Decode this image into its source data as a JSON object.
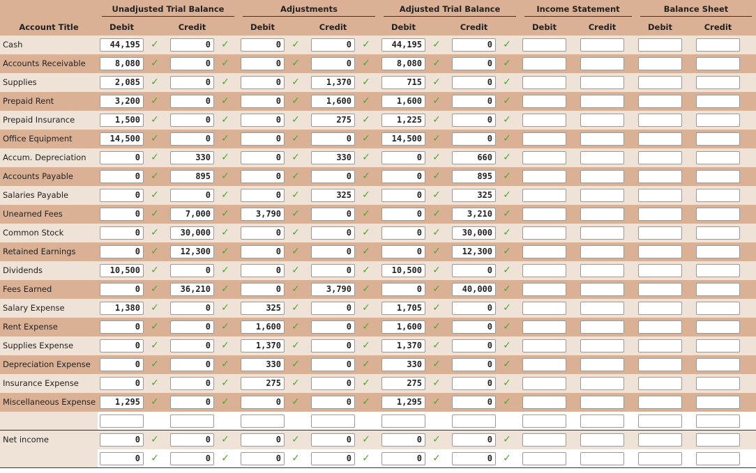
{
  "headers": {
    "groups": [
      "Unadjusted Trial Balance",
      "Adjustments",
      "Adjusted Trial Balance",
      "Income Statement",
      "Balance Sheet"
    ],
    "account_title": "Account Title",
    "debit": "Debit",
    "credit": "Credit"
  },
  "check_glyph": "✓",
  "accounts": [
    {
      "title": "Cash",
      "values": [
        "44,195",
        "0",
        "0",
        "0",
        "44,195",
        "0"
      ]
    },
    {
      "title": "Accounts Receivable",
      "values": [
        "8,080",
        "0",
        "0",
        "0",
        "8,080",
        "0"
      ]
    },
    {
      "title": "Supplies",
      "values": [
        "2,085",
        "0",
        "0",
        "1,370",
        "715",
        "0"
      ]
    },
    {
      "title": "Prepaid Rent",
      "values": [
        "3,200",
        "0",
        "0",
        "1,600",
        "1,600",
        "0"
      ]
    },
    {
      "title": "Prepaid Insurance",
      "values": [
        "1,500",
        "0",
        "0",
        "275",
        "1,225",
        "0"
      ]
    },
    {
      "title": "Office Equipment",
      "values": [
        "14,500",
        "0",
        "0",
        "0",
        "14,500",
        "0"
      ]
    },
    {
      "title": "Accum. Depreciation",
      "values": [
        "0",
        "330",
        "0",
        "330",
        "0",
        "660"
      ]
    },
    {
      "title": "Accounts Payable",
      "values": [
        "0",
        "895",
        "0",
        "0",
        "0",
        "895"
      ]
    },
    {
      "title": "Salaries Payable",
      "values": [
        "0",
        "0",
        "0",
        "325",
        "0",
        "325"
      ]
    },
    {
      "title": "Unearned Fees",
      "values": [
        "0",
        "7,000",
        "3,790",
        "0",
        "0",
        "3,210"
      ]
    },
    {
      "title": "Common Stock",
      "values": [
        "0",
        "30,000",
        "0",
        "0",
        "0",
        "30,000"
      ]
    },
    {
      "title": "Retained Earnings",
      "values": [
        "0",
        "12,300",
        "0",
        "0",
        "0",
        "12,300"
      ]
    },
    {
      "title": "Dividends",
      "values": [
        "10,500",
        "0",
        "0",
        "0",
        "10,500",
        "0"
      ]
    },
    {
      "title": "Fees Earned",
      "values": [
        "0",
        "36,210",
        "0",
        "3,790",
        "0",
        "40,000"
      ]
    },
    {
      "title": "Salary Expense",
      "values": [
        "1,380",
        "0",
        "325",
        "0",
        "1,705",
        "0"
      ]
    },
    {
      "title": "Rent Expense",
      "values": [
        "0",
        "0",
        "1,600",
        "0",
        "1,600",
        "0"
      ]
    },
    {
      "title": "Supplies Expense",
      "values": [
        "0",
        "0",
        "1,370",
        "0",
        "1,370",
        "0"
      ]
    },
    {
      "title": "Depreciation Expense",
      "values": [
        "0",
        "0",
        "330",
        "0",
        "330",
        "0"
      ]
    },
    {
      "title": "Insurance Expense",
      "values": [
        "0",
        "0",
        "275",
        "0",
        "275",
        "0"
      ]
    },
    {
      "title": "Miscellaneous Expense",
      "values": [
        "1,295",
        "0",
        "0",
        "0",
        "1,295",
        "0"
      ]
    }
  ],
  "blank_row": {
    "title": "",
    "values": [
      "",
      "",
      "",
      "",
      "",
      ""
    ]
  },
  "net_income_row": {
    "title": "Net income",
    "values": [
      "0",
      "0",
      "0",
      "0",
      "0",
      "0"
    ]
  },
  "totals_row": {
    "title": "",
    "values": [
      "0",
      "0",
      "0",
      "0",
      "0",
      "0"
    ]
  }
}
